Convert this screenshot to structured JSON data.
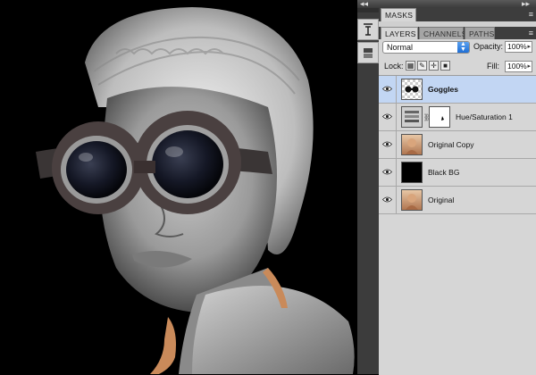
{
  "panels": {
    "masks_tab": "MASKS",
    "tabs": [
      {
        "label": "LAYERS",
        "active": true
      },
      {
        "label": "CHANNELS",
        "active": false
      },
      {
        "label": "PATHS",
        "active": false
      }
    ]
  },
  "layers_panel": {
    "blend_mode": "Normal",
    "opacity_label": "Opacity:",
    "opacity_value": "100%",
    "lock_label": "Lock:",
    "fill_label": "Fill:",
    "fill_value": "100%",
    "layers": [
      {
        "name": "Goggles",
        "selected": true,
        "visible": true,
        "thumb": "transparent-goggles"
      },
      {
        "name": "Hue/Saturation 1",
        "selected": false,
        "visible": true,
        "thumb": "adjustment-with-mask"
      },
      {
        "name": "Original Copy",
        "selected": false,
        "visible": true,
        "thumb": "portrait"
      },
      {
        "name": "Black BG",
        "selected": false,
        "visible": true,
        "thumb": "black-fill"
      },
      {
        "name": "Original",
        "selected": false,
        "visible": true,
        "thumb": "portrait"
      }
    ]
  },
  "colors": {
    "selection": "#c2d6f3",
    "panel_bg": "#d6d6d6",
    "canvas_bg": "#000000",
    "skin_tone": "#c98a5a"
  }
}
